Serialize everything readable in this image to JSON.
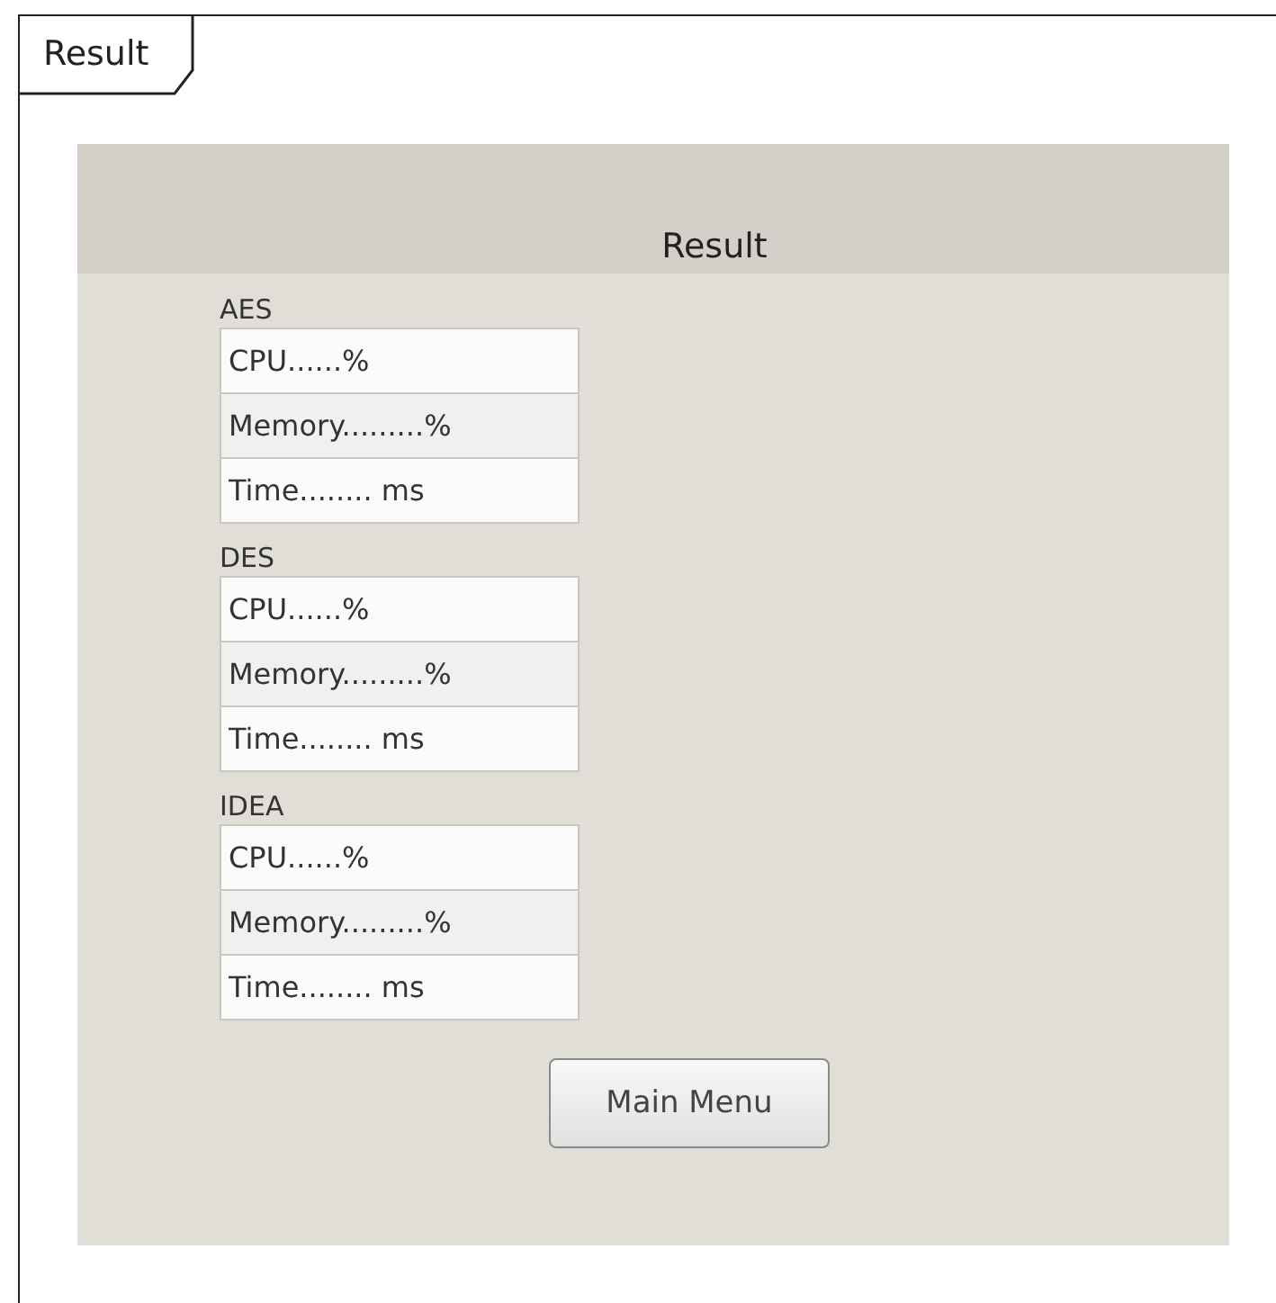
{
  "frame": {
    "title": "Result"
  },
  "panel": {
    "title": "Result",
    "groups": [
      {
        "label": "AES",
        "fields": [
          {
            "value": "CPU......%"
          },
          {
            "value": "Memory.........%"
          },
          {
            "value": "Time........ ms"
          }
        ]
      },
      {
        "label": "DES",
        "fields": [
          {
            "value": "CPU......%"
          },
          {
            "value": "Memory.........%"
          },
          {
            "value": "Time........ ms"
          }
        ]
      },
      {
        "label": "IDEA",
        "fields": [
          {
            "value": "CPU......%"
          },
          {
            "value": "Memory.........%"
          },
          {
            "value": "Time........ ms"
          }
        ]
      }
    ]
  },
  "buttons": [
    {
      "label": "Main Menu"
    }
  ]
}
